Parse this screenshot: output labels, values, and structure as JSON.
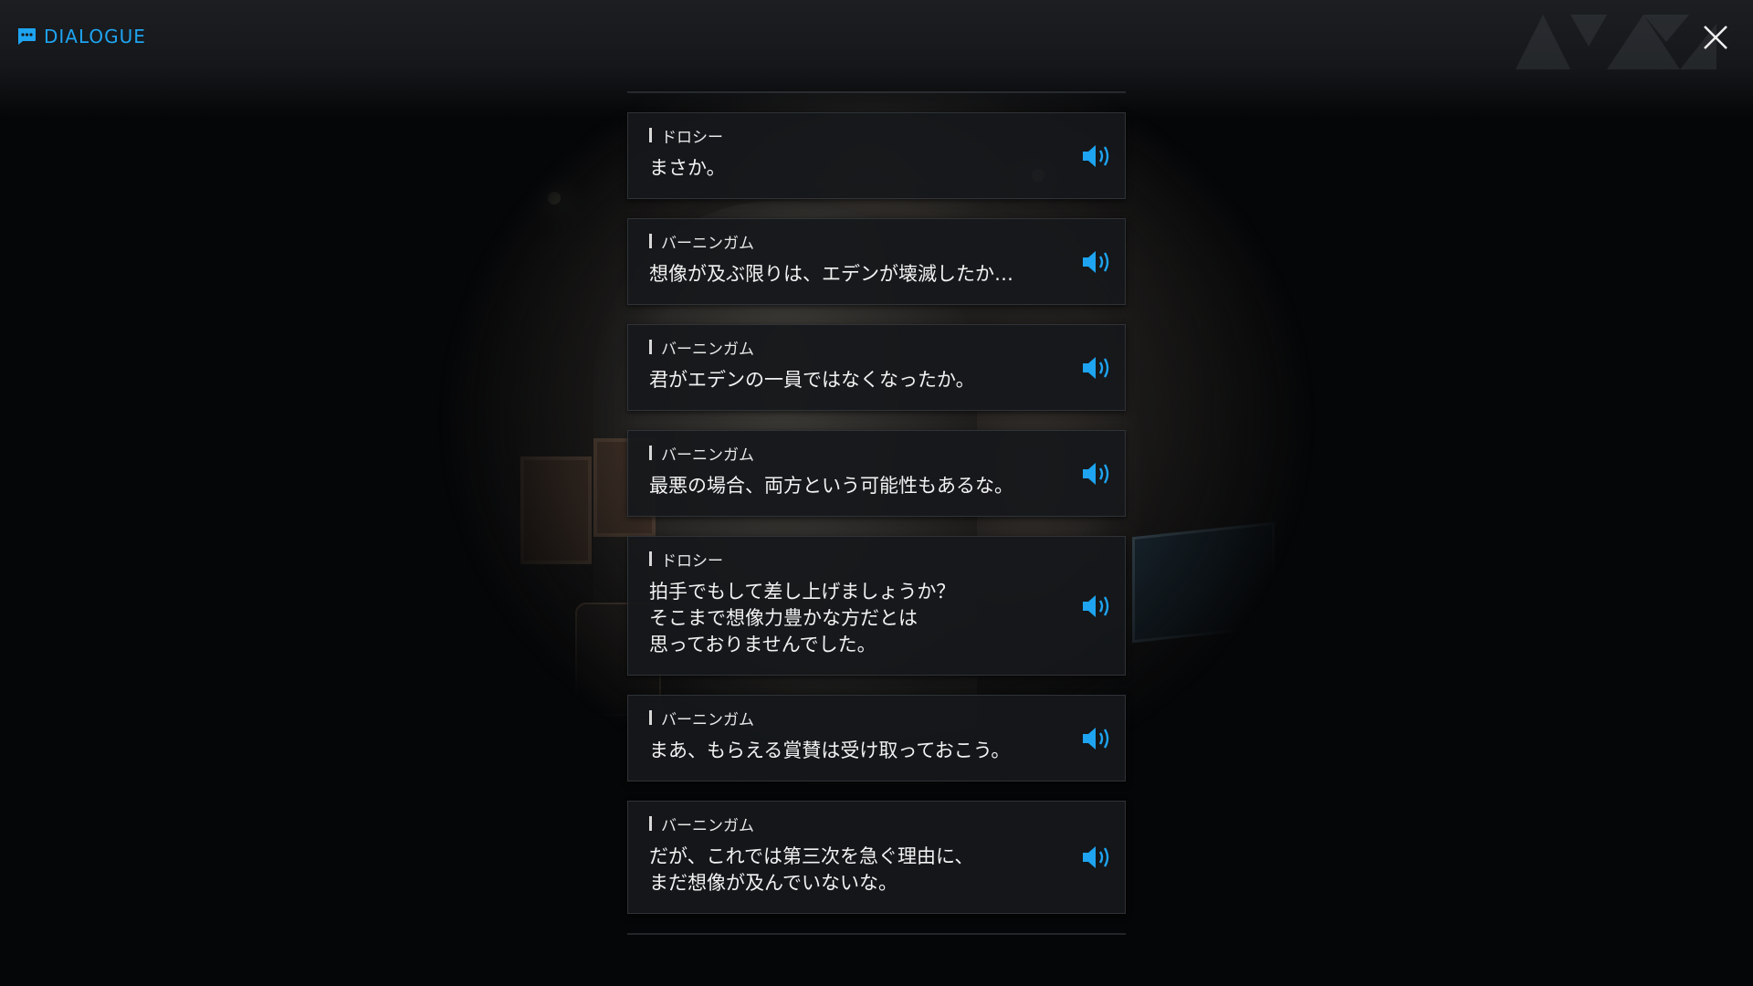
{
  "header": {
    "title": "DIALOGUE",
    "icon": "chat-icon",
    "close_icon": "close-icon"
  },
  "colors": {
    "accent": "#1ea4f0",
    "card_bg": "#16181b",
    "text": "#f2f2f2"
  },
  "dialogue": [
    {
      "speaker": "ドロシー",
      "text": "まさか。",
      "voice_icon": "speaker-icon"
    },
    {
      "speaker": "バーニンガム",
      "text": "想像が及ぶ限りは、エデンが壊滅したか…",
      "voice_icon": "speaker-icon"
    },
    {
      "speaker": "バーニンガム",
      "text": "君がエデンの一員ではなくなったか。",
      "voice_icon": "speaker-icon"
    },
    {
      "speaker": "バーニンガム",
      "text": "最悪の場合、両方という可能性もあるな。",
      "voice_icon": "speaker-icon"
    },
    {
      "speaker": "ドロシー",
      "text": "拍手でもして差し上げましょうか？\nそこまで想像力豊かな方だとは\n思っておりませんでした。",
      "voice_icon": "speaker-icon"
    },
    {
      "speaker": "バーニンガム",
      "text": "まあ、もらえる賞賛は受け取っておこう。",
      "voice_icon": "speaker-icon"
    },
    {
      "speaker": "バーニンガム",
      "text": "だが、これでは第三次を急ぐ理由に、\nまだ想像が及んでいないな。",
      "voice_icon": "speaker-icon"
    }
  ]
}
